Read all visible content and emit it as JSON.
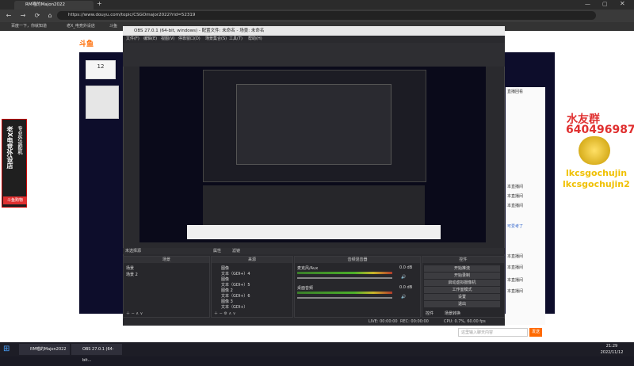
{
  "browser": {
    "tabs": [
      {
        "label": "RM喵的Majon2022"
      },
      {
        "label": "+"
      }
    ],
    "url": "https://www.douyu.com/topic/CSGOmajor2022?rid=52319",
    "bookmarks": [
      "百度一下，你就知道",
      "老X_电竞外设店",
      "斗鱼"
    ]
  },
  "site": {
    "logo": "斗鱼",
    "left_count": "12",
    "side_banner": "老X电竞外设店",
    "side_banner2": "专业外设配机",
    "side_label": "斗鱼购物"
  },
  "obs": {
    "title": "OBS 27.0.1 (64-bit, windows) - 配置文件: 未命名 - 场景: 未命名",
    "menu": [
      "文件(F)",
      "编辑(E)",
      "视图(V)",
      "停靠窗口(D)",
      "场景集合(S)",
      "工具(T)",
      "帮助(H)"
    ],
    "no_source": "未选择源",
    "props_label": "属性",
    "filters_label": "滤镜",
    "panels": {
      "scenes": "场景",
      "sources": "来源",
      "mixer": "音频混音器",
      "controls": "控件"
    },
    "scenes": [
      "场景",
      "场景 2"
    ],
    "sources": [
      "图像",
      "文本（GDI+）4",
      "图像",
      "文本（GDI+）5",
      "图像 2",
      "文本（GDI+）6",
      "图像 3",
      "文本（GDI+）"
    ],
    "mixer": [
      {
        "name": "麦克风/Aux",
        "db": "0.0 dB"
      },
      {
        "name": "桌面音频",
        "db": "0.0 dB"
      }
    ],
    "controls": [
      "开始推流",
      "开始录制",
      "启动虚拟摄像机",
      "工作室模式",
      "设置",
      "退出"
    ],
    "tabs": [
      "控件",
      "场景转换"
    ],
    "status": {
      "live": "LIVE: 00:00:00",
      "rec": "REC: 00:00:00",
      "cpu": "CPU: 0.7%, 60.00 fps"
    }
  },
  "ads": {
    "shui": "水友群",
    "num": "640496987",
    "name1": "lkcsgochujin",
    "name2": "lkcsgochujin2"
  },
  "right_list": [
    "直播回看",
    "本直播间",
    "本直播间",
    "本直播间",
    "可爱考了",
    "本直播间",
    "本直播间",
    "本直播间",
    "本直播间"
  ],
  "taskbar": {
    "items": [
      "RM喵的Majon2022",
      "OBS 27.0.1 (64-bit..."
    ],
    "time": "21:29",
    "date": "2022/11/12"
  },
  "chat": {
    "placeholder": "这里输入聊天内容",
    "send": "发送"
  }
}
